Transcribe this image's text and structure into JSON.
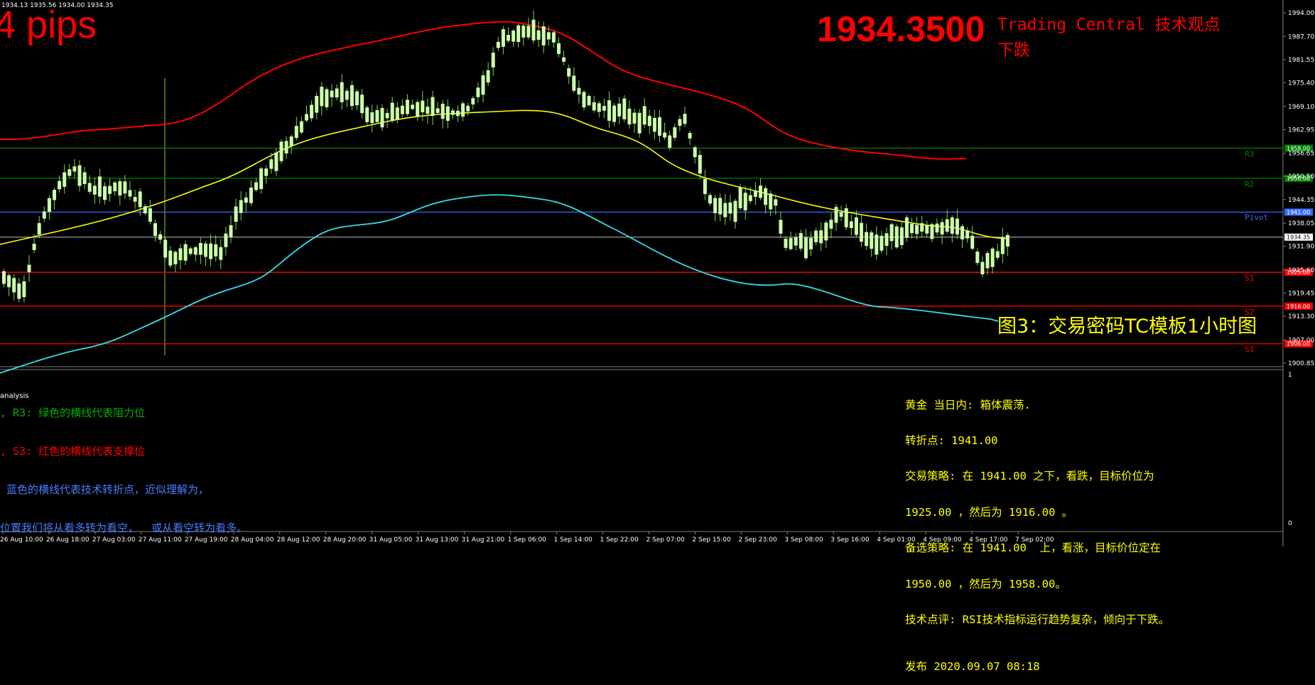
{
  "header": {
    "ohlc": "1934.13 1935.56 1934.00 1934.35",
    "pips": "4 pips",
    "price": "1934.3500",
    "tc_title": "Trading Central 技术观点",
    "tc_view": "下跌",
    "caption": "图3：交易密码TC模板1小时图"
  },
  "price_axis": {
    "ticks": [
      "1994.00",
      "1987.70",
      "1981.55",
      "1975.40",
      "1969.10",
      "1962.95",
      "1956.65",
      "1950.50",
      "1944.35",
      "1938.05",
      "1931.90",
      "1925.60",
      "1919.45",
      "1913.30",
      "1907.00",
      "1900.85"
    ],
    "current": "1934.35"
  },
  "levels": [
    {
      "name": "R3",
      "value": "1958.00",
      "color": "#008000",
      "tag_color": "#008000"
    },
    {
      "name": "R2",
      "value": "1950.00",
      "color": "#008000",
      "tag_color": "#008000"
    },
    {
      "name": "Pivot",
      "value": "1941.00",
      "color": "#3a6cff",
      "tag_color": "#3a6cff"
    },
    {
      "name": "S1",
      "value": "1925.00",
      "color": "#ff0000",
      "tag_color": "#ff0000"
    },
    {
      "name": "S2",
      "value": "1916.00",
      "color": "#ff0000",
      "tag_color": "#ff0000"
    },
    {
      "name": "S3",
      "value": "1906.00",
      "color": "#ff0000",
      "tag_color": "#ff0000"
    }
  ],
  "colors": {
    "up_candle": "#ccffaa",
    "wick": "#7fd34a",
    "upper_band": "#ff0000",
    "mid_band": "#ffff00",
    "lower_band": "#33ddee",
    "current_line": "#c0c0c0",
    "grid": "#808080"
  },
  "indicator": {
    "title": "analysis",
    "axis_top": "1",
    "axis_bottom": "0",
    "legend": [
      ", R3: 绿色的横线代表阻力位",
      ", S3: 红色的横线代表支撑位",
      " 蓝色的横线代表技术转折点，近似理解为，",
      "位置我们将从看多转为看空，  或从看空转为看多。"
    ],
    "analysis_lines": [
      "黄金 当日内: 箱体震荡.",
      "转折点: 1941.00",
      "交易策略: 在 1941.00 之下，看跌，目标价位为",
      "1925.00 ，然后为 1916.00 。",
      "备选策略: 在 1941.00  上，看涨，目标价位定在",
      "1950.00 ，然后为 1958.00。",
      "技术点评: RSI技术指标运行趋势复杂，倾向于下跌。"
    ],
    "published": "发布 2020.09.07 08:18"
  },
  "time_axis": [
    "26 Aug 10:00",
    "26 Aug 18:00",
    "27 Aug 03:00",
    "27 Aug 11:00",
    "27 Aug 19:00",
    "28 Aug 04:00",
    "28 Aug 12:00",
    "28 Aug 20:00",
    "31 Aug 05:00",
    "31 Aug 13:00",
    "31 Aug 21:00",
    "1 Sep 06:00",
    "1 Sep 14:00",
    "1 Sep 22:00",
    "2 Sep 07:00",
    "2 Sep 15:00",
    "2 Sep 23:00",
    "3 Sep 08:00",
    "3 Sep 16:00",
    "4 Sep 01:00",
    "4 Sep 09:00",
    "4 Sep 17:00",
    "7 Sep 02:00"
  ]
}
